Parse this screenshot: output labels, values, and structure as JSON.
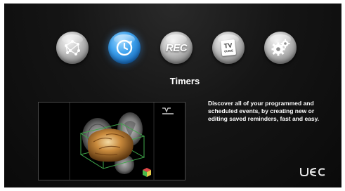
{
  "menu": {
    "items": [
      {
        "id": "network",
        "icon": "network-globe-icon",
        "label": ""
      },
      {
        "id": "timers",
        "icon": "clock-refresh-icon",
        "label": "",
        "active": true
      },
      {
        "id": "rec",
        "icon": "rec-icon",
        "label": "REC"
      },
      {
        "id": "tv-guide",
        "icon": "tv-guide-icon",
        "label": "TV",
        "sublabel": "GUIDE"
      },
      {
        "id": "settings",
        "icon": "gears-icon",
        "label": ""
      }
    ],
    "active_color": "#2f8fe0"
  },
  "section": {
    "title": "Timers",
    "description": "Discover all of your programmed and scheduled events, by creating new or editing saved reminders, fast and easy."
  },
  "brand": {
    "logo_text": "UEC"
  },
  "preview": {
    "image": "brain-mri-3d-render",
    "badge": "MRI-logo-icon"
  }
}
